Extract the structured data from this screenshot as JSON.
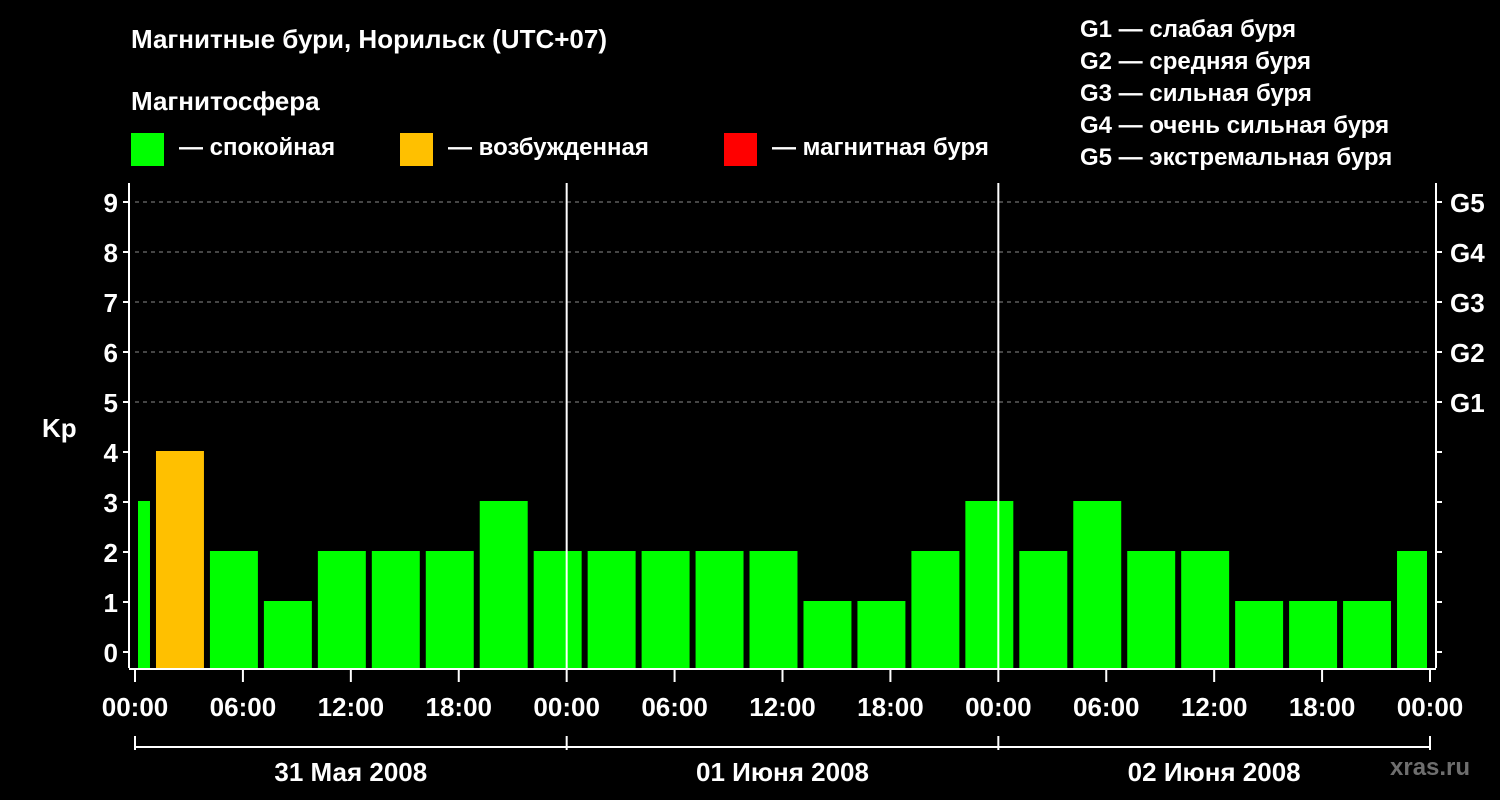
{
  "title": "Магнитные бури, Норильск (UTC+07)",
  "legend": {
    "heading": "Магнитосфера",
    "items": [
      {
        "label": "— спокойная",
        "color": "#00ff00"
      },
      {
        "label": "— возбужденная",
        "color": "#ffc000"
      },
      {
        "label": "— магнитная буря",
        "color": "#ff0000"
      }
    ]
  },
  "storm_scale": [
    "G1 — слабая буря",
    "G2 — средняя буря",
    "G3 — сильная буря",
    "G4 — очень сильная буря",
    "G5 — экстремальная буря"
  ],
  "credit": "xras.ru",
  "chart_data": {
    "type": "bar",
    "title": "Магнитные бури, Норильск (UTC+07)",
    "ylabel": "Kp",
    "ylim": [
      0,
      9
    ],
    "yticks": [
      0,
      1,
      2,
      3,
      4,
      5,
      6,
      7,
      8,
      9
    ],
    "right_ticks": [
      {
        "value": 5,
        "label": "G1"
      },
      {
        "value": 6,
        "label": "G2"
      },
      {
        "value": 7,
        "label": "G3"
      },
      {
        "value": 8,
        "label": "G4"
      },
      {
        "value": 9,
        "label": "G5"
      }
    ],
    "x_range_hours": [
      0,
      72
    ],
    "xtick_labels": [
      "00:00",
      "06:00",
      "12:00",
      "18:00",
      "00:00",
      "06:00",
      "12:00",
      "18:00",
      "00:00",
      "06:00",
      "12:00",
      "18:00",
      "00:00"
    ],
    "days": [
      "31 Мая 2008",
      "01 Июня 2008",
      "02 Июня 2008"
    ],
    "bars": [
      {
        "start": "00:00",
        "end": "01:00",
        "kp": 3,
        "state": "спокойная"
      },
      {
        "start": "01:00",
        "end": "04:00",
        "kp": 4,
        "state": "возбужденная"
      },
      {
        "start": "04:00",
        "end": "07:00",
        "kp": 2,
        "state": "спокойная"
      },
      {
        "start": "07:00",
        "end": "10:00",
        "kp": 1,
        "state": "спокойная"
      },
      {
        "start": "10:00",
        "end": "13:00",
        "kp": 2,
        "state": "спокойная"
      },
      {
        "start": "13:00",
        "end": "16:00",
        "kp": 2,
        "state": "спокойная"
      },
      {
        "start": "16:00",
        "end": "19:00",
        "kp": 2,
        "state": "спокойная"
      },
      {
        "start": "19:00",
        "end": "22:00",
        "kp": 3,
        "state": "спокойная"
      },
      {
        "start": "22:00",
        "end": "01:00",
        "kp": 2,
        "state": "спокойная"
      },
      {
        "start": "01:00",
        "end": "04:00",
        "kp": 2,
        "state": "спокойная"
      },
      {
        "start": "04:00",
        "end": "07:00",
        "kp": 2,
        "state": "спокойная"
      },
      {
        "start": "07:00",
        "end": "10:00",
        "kp": 2,
        "state": "спокойная"
      },
      {
        "start": "10:00",
        "end": "13:00",
        "kp": 2,
        "state": "спокойная"
      },
      {
        "start": "13:00",
        "end": "16:00",
        "kp": 1,
        "state": "спокойная"
      },
      {
        "start": "16:00",
        "end": "19:00",
        "kp": 1,
        "state": "спокойная"
      },
      {
        "start": "19:00",
        "end": "22:00",
        "kp": 2,
        "state": "спокойная"
      },
      {
        "start": "22:00",
        "end": "01:00",
        "kp": 3,
        "state": "спокойная"
      },
      {
        "start": "01:00",
        "end": "04:00",
        "kp": 2,
        "state": "спокойная"
      },
      {
        "start": "04:00",
        "end": "07:00",
        "kp": 3,
        "state": "спокойная"
      },
      {
        "start": "07:00",
        "end": "10:00",
        "kp": 2,
        "state": "спокойная"
      },
      {
        "start": "10:00",
        "end": "13:00",
        "kp": 2,
        "state": "спокойная"
      },
      {
        "start": "13:00",
        "end": "16:00",
        "kp": 1,
        "state": "спокойная"
      },
      {
        "start": "16:00",
        "end": "19:00",
        "kp": 1,
        "state": "спокойная"
      },
      {
        "start": "19:00",
        "end": "22:00",
        "kp": 1,
        "state": "спокойная"
      },
      {
        "start": "22:00",
        "end": "00:00",
        "kp": 2,
        "state": "спокойная"
      }
    ],
    "grid": "dashed horizontal at 5–9"
  }
}
